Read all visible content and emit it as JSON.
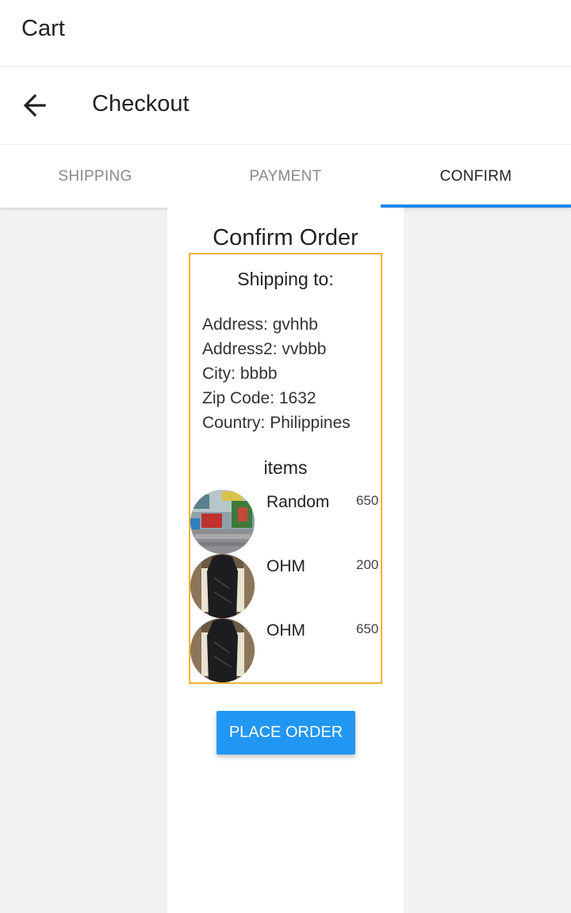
{
  "app": {
    "title": "Cart"
  },
  "header": {
    "title": "Checkout",
    "back_icon": "arrow-left-icon"
  },
  "tabs": [
    {
      "label": "SHIPPING",
      "active": false
    },
    {
      "label": "PAYMENT",
      "active": false
    },
    {
      "label": "CONFIRM",
      "active": true
    }
  ],
  "accent_color": "#1e88e5",
  "confirm": {
    "title": "Confirm Order",
    "shipping_heading": "Shipping to:",
    "address_lines": [
      "Address: gvhhb",
      "Address2: vvbbb",
      "City: bbbb",
      "Zip Code: 1632",
      "Country: Philippines"
    ],
    "items_heading": "items",
    "items": [
      {
        "name": "Random",
        "price": "650",
        "image": "street-market-photo"
      },
      {
        "name": "OHM",
        "price": "200",
        "image": "black-dress-photo"
      },
      {
        "name": "OHM",
        "price": "650",
        "image": "black-dress-photo"
      }
    ],
    "place_order_label": "PLACE ORDER",
    "box_border_color": "#f0b429",
    "button_color": "#2196f3"
  }
}
